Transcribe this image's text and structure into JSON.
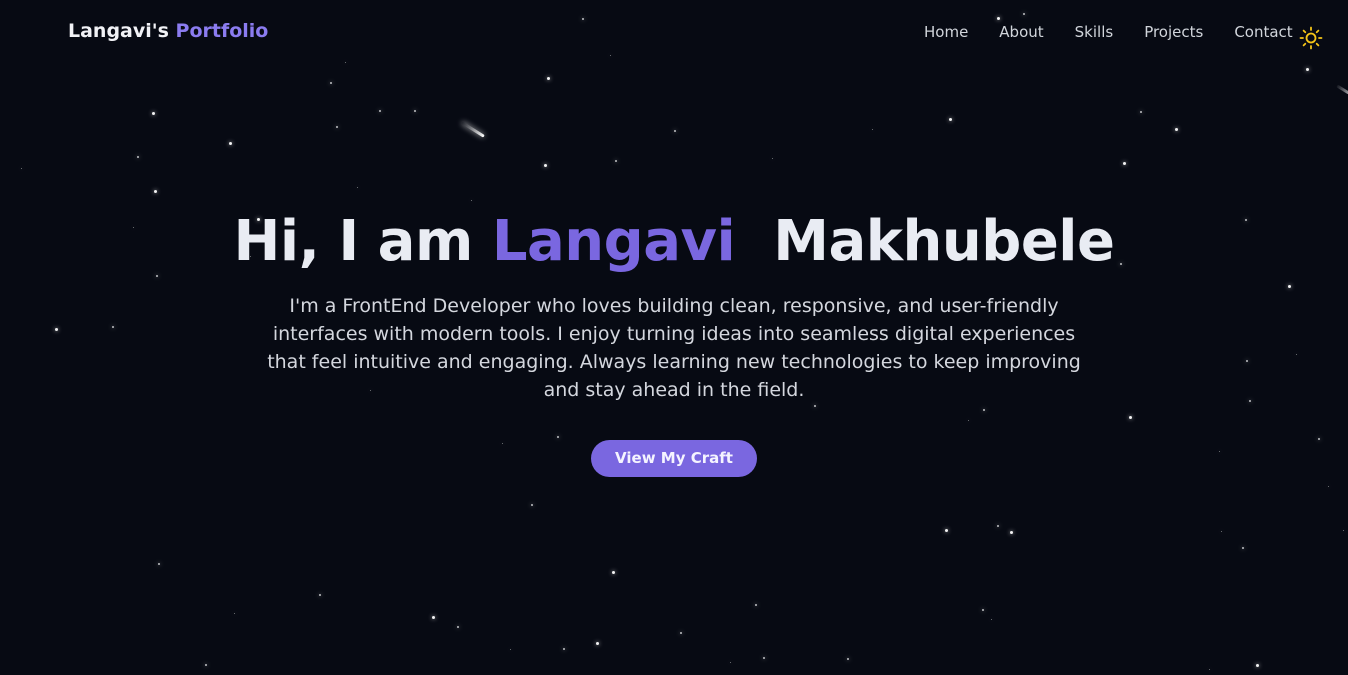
{
  "brand": {
    "name": "Langavi's",
    "accent": "Portfolio"
  },
  "nav": {
    "items": [
      {
        "label": "Home"
      },
      {
        "label": "About"
      },
      {
        "label": "Skills"
      },
      {
        "label": "Projects"
      },
      {
        "label": "Contact"
      }
    ],
    "theme_toggle_icon": "sun-icon"
  },
  "hero": {
    "greeting": "Hi, I am",
    "first_name": "Langavi",
    "last_name": "Makhubele",
    "description": "I'm a FrontEnd Developer who loves building clean, responsive, and user-friendly interfaces with modern tools. I enjoy turning ideas into seamless digital experiences that feel intuitive and engaging. Always learning new technologies to keep improving and stay ahead in the field.",
    "cta_label": "View My Craft"
  },
  "colors": {
    "background": "#070a13",
    "accent": "#7a67e0",
    "text": "#e9ecf3",
    "sun": "#f5c518"
  }
}
